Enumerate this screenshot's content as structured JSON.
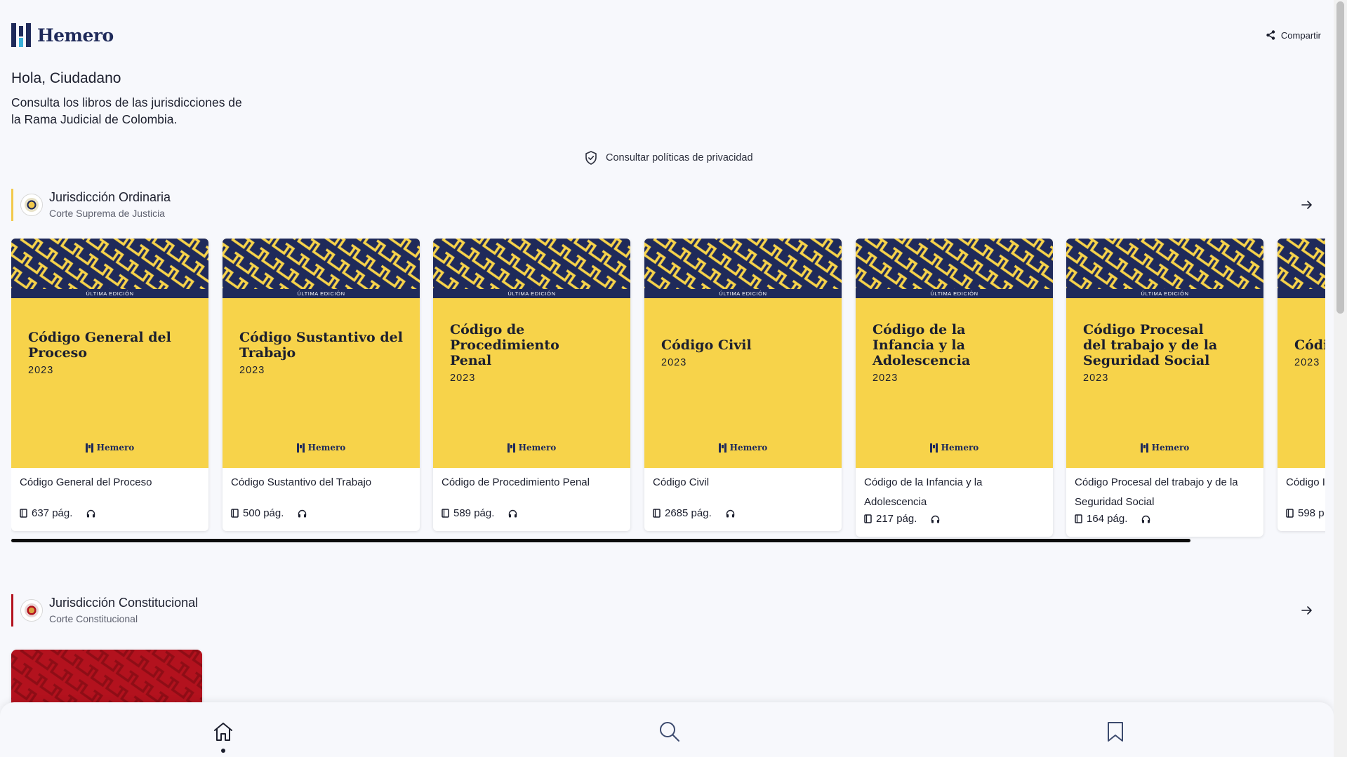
{
  "app": {
    "name": "Hemero"
  },
  "header": {
    "share_label": "Compartir"
  },
  "greeting": "Hola, Ciudadano",
  "intro": "Consulta los libros de las jurisdicciones de la Rama Judicial de Colombia.",
  "privacy_link": "Consultar políticas de privacidad",
  "colors": {
    "navy": "#1f2a5a",
    "cover_yellow": "#f7d34a",
    "constitutional_red": "#b3121e",
    "accent_yellow": "#f2c94c",
    "accent_red": "#b3121e"
  },
  "sections": [
    {
      "title": "Jurisdicción Ordinaria",
      "subtitle": "Corte Suprema de Justicia",
      "books": [
        {
          "cover_title": "Código General del Proceso",
          "year": "2023",
          "edition": "ÚLTIMA EDICIÓN",
          "brand": "Hemero",
          "label": "Código General del Proceso",
          "pages": "637 pág."
        },
        {
          "cover_title": "Código Sustantivo del Trabajo",
          "year": "2023",
          "edition": "ÚLTIMA EDICIÓN",
          "brand": "Hemero",
          "label": "Código Sustantivo del Trabajo",
          "pages": "500 pág."
        },
        {
          "cover_title": "Código de Procedimiento Penal",
          "year": "2023",
          "edition": "ÚLTIMA EDICIÓN",
          "brand": "Hemero",
          "label": "Código de Procedimiento Penal",
          "pages": "589 pág."
        },
        {
          "cover_title": "Código Civil",
          "year": "2023",
          "edition": "ÚLTIMA EDICIÓN",
          "brand": "Hemero",
          "label": "Código Civil",
          "pages": "2685 pág."
        },
        {
          "cover_title": "Código de la Infancia y la Adolescencia",
          "year": "2023",
          "edition": "ÚLTIMA EDICIÓN",
          "brand": "Hemero",
          "label": "Código de la Infancia y la Adolescencia",
          "pages": "217 pág."
        },
        {
          "cover_title": "Código Procesal del trabajo y de la Seguridad Social",
          "year": "2023",
          "edition": "ÚLTIMA EDICIÓN",
          "brand": "Hemero",
          "label": "Código Procesal del trabajo y de la Seguridad Social",
          "pages": "164 pág."
        },
        {
          "cover_title": "Códi",
          "year": "2023",
          "edition": "",
          "brand": "",
          "label": "Código I",
          "pages": "598 p"
        }
      ]
    },
    {
      "title": "Jurisdicción Constitucional",
      "subtitle": "Corte Constitucional",
      "books": []
    }
  ],
  "bottom_nav": [
    {
      "id": "home",
      "icon": "home-icon",
      "active": true
    },
    {
      "id": "search",
      "icon": "search-icon",
      "active": false
    },
    {
      "id": "saved",
      "icon": "bookmark-icon",
      "active": false
    }
  ]
}
